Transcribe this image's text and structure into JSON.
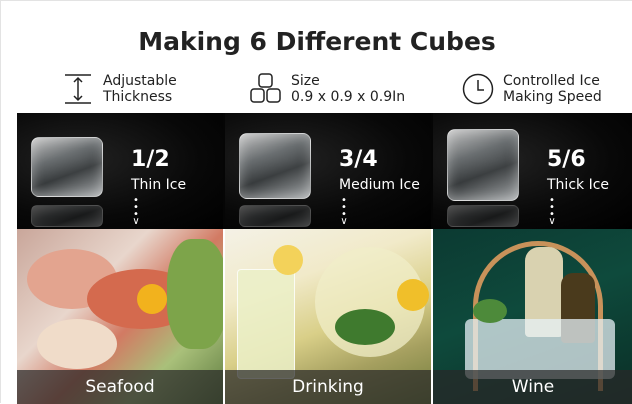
{
  "title": "Making 6 Different Cubes",
  "features": [
    {
      "icon": "thickness-arrows-icon",
      "lines": [
        "Adjustable",
        "Thickness"
      ]
    },
    {
      "icon": "ice-cubes-icon",
      "lines": [
        "Size",
        "0.9 x 0.9 x 0.9In"
      ]
    },
    {
      "icon": "clock-icon",
      "lines": [
        "Controlled Ice",
        "Making Speed"
      ]
    }
  ],
  "cubes": [
    {
      "ratio": "1/2",
      "kind": "Thin Ice"
    },
    {
      "ratio": "3/4",
      "kind": "Medium Ice"
    },
    {
      "ratio": "5/6",
      "kind": "Thick Ice"
    }
  ],
  "uses": [
    {
      "label": "Seafood"
    },
    {
      "label": "Drinking"
    },
    {
      "label": "Wine"
    }
  ],
  "colors": {
    "band": "#050505",
    "label_bg": "#282828",
    "text": "#222222"
  }
}
